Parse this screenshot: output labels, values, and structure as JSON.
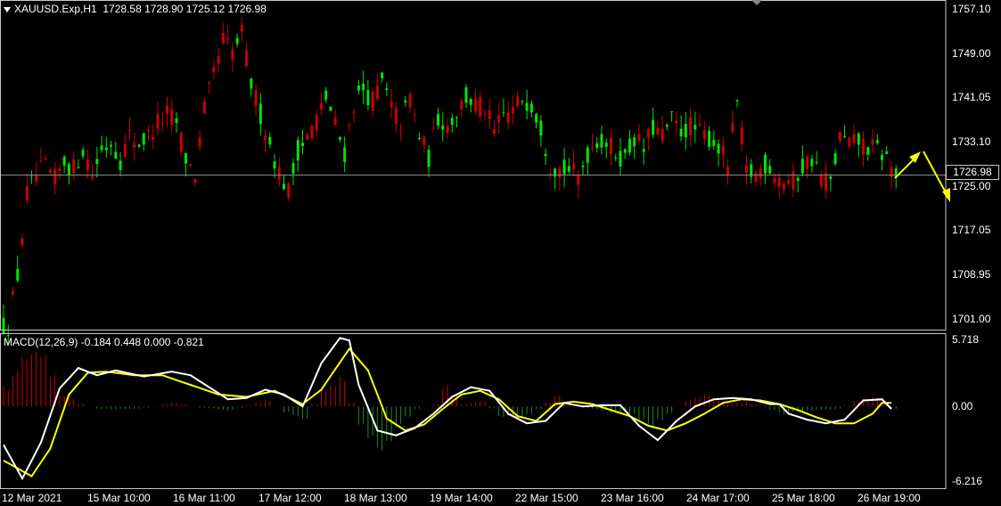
{
  "symbol_header": {
    "symbol": "XAUUSD.Exp,H1",
    "ohlc": "1728.58 1728.90 1725.12 1726.98"
  },
  "current_price": "1726.98",
  "macd_header": "MACD(12,26,9) -0.184 0.448 0.000 -0.821",
  "price_axis": [
    "1757.10",
    "1749.00",
    "1741.05",
    "1733.10",
    "1725.00",
    "1717.05",
    "1708.95",
    "1701.00"
  ],
  "macd_axis": [
    "5.718",
    "0.00",
    "-6.216"
  ],
  "time_axis": [
    "12 Mar 2021",
    "15 Mar 10:00",
    "16 Mar 11:00",
    "17 Mar 12:00",
    "18 Mar 13:00",
    "19 Mar 14:00",
    "22 Mar 15:00",
    "23 Mar 16:00",
    "24 Mar 17:00",
    "25 Mar 18:00",
    "26 Mar 19:00"
  ],
  "colors": {
    "bull": "#00e600",
    "bear": "#cc0000",
    "macd_line": "#ffffff",
    "signal_line": "#ffff00",
    "hist_pos": "#cc0000",
    "hist_neg": "#1f8a1f",
    "arrow": "#ffff00",
    "grid": "#c8c8c8"
  },
  "chart_data": {
    "type": "line",
    "price_range": [
      1699.0,
      1758.5
    ],
    "macd_range": [
      -6.8,
      6.1
    ],
    "close_path": [
      [
        0,
        1699.8
      ],
      [
        0.5,
        1705.0
      ],
      [
        1,
        1708.8
      ],
      [
        1.5,
        1717.5
      ],
      [
        2,
        1723.5
      ],
      [
        3,
        1727.0
      ],
      [
        4,
        1728.2
      ],
      [
        5,
        1726.0
      ],
      [
        6,
        1729.4
      ],
      [
        7,
        1728.0
      ],
      [
        8,
        1731.8
      ],
      [
        9,
        1727.2
      ],
      [
        10,
        1731.5
      ],
      [
        11,
        1733.0
      ],
      [
        12,
        1729.8
      ],
      [
        13,
        1734.0
      ],
      [
        14,
        1732.8
      ],
      [
        15,
        1734.0
      ],
      [
        16,
        1736.5
      ],
      [
        17,
        1738.0
      ],
      [
        18,
        1736.4
      ],
      [
        19,
        1730.0
      ],
      [
        20,
        1727.0
      ],
      [
        21,
        1738.8
      ],
      [
        22,
        1745.0
      ],
      [
        23,
        1751.5
      ],
      [
        24,
        1749.2
      ],
      [
        25,
        1752.5
      ],
      [
        26,
        1743.5
      ],
      [
        27,
        1738.0
      ],
      [
        28,
        1732.5
      ],
      [
        29,
        1727.5
      ],
      [
        30,
        1724.0
      ],
      [
        31,
        1731.5
      ],
      [
        32,
        1733.8
      ],
      [
        33,
        1737.0
      ],
      [
        34,
        1741.0
      ],
      [
        35,
        1736.0
      ],
      [
        36,
        1731.0
      ],
      [
        37,
        1740.0
      ],
      [
        38,
        1742.5
      ],
      [
        39,
        1740.5
      ],
      [
        40,
        1743.8
      ],
      [
        41,
        1739.0
      ],
      [
        42,
        1736.2
      ],
      [
        43,
        1741.0
      ],
      [
        44,
        1734.0
      ],
      [
        45,
        1730.2
      ],
      [
        46,
        1737.5
      ],
      [
        47,
        1736.0
      ],
      [
        48,
        1738.5
      ],
      [
        49,
        1741.0
      ],
      [
        50,
        1739.8
      ],
      [
        51,
        1739.0
      ],
      [
        52,
        1734.5
      ],
      [
        53,
        1737.8
      ],
      [
        54,
        1738.5
      ],
      [
        55,
        1741.0
      ],
      [
        56,
        1740.0
      ],
      [
        57,
        1735.8
      ],
      [
        58,
        1729.0
      ],
      [
        59,
        1728.0
      ],
      [
        60,
        1727.8
      ],
      [
        61,
        1726.5
      ],
      [
        62,
        1731.0
      ],
      [
        63,
        1733.5
      ],
      [
        64,
        1732.8
      ],
      [
        65,
        1731.0
      ],
      [
        66,
        1730.0
      ],
      [
        67,
        1733.8
      ],
      [
        68,
        1731.5
      ],
      [
        69,
        1735.5
      ],
      [
        70,
        1734.0
      ],
      [
        71,
        1736.8
      ],
      [
        72,
        1735.0
      ],
      [
        73,
        1735.8
      ],
      [
        74,
        1734.5
      ],
      [
        75,
        1733.8
      ],
      [
        76,
        1732.0
      ],
      [
        77,
        1729.0
      ],
      [
        78,
        1740.0
      ],
      [
        79,
        1727.5
      ],
      [
        80,
        1727.0
      ],
      [
        81,
        1729.0
      ],
      [
        82,
        1727.5
      ],
      [
        83,
        1726.0
      ],
      [
        84,
        1725.8
      ],
      [
        85,
        1728.5
      ],
      [
        86,
        1730.0
      ],
      [
        87,
        1726.8
      ],
      [
        88,
        1725.5
      ],
      [
        89,
        1733.8
      ],
      [
        90,
        1732.5
      ],
      [
        91,
        1733.0
      ],
      [
        92,
        1732.0
      ],
      [
        93,
        1731.5
      ],
      [
        94,
        1730.0
      ],
      [
        95,
        1726.98
      ]
    ],
    "macd_path": [
      [
        0,
        -3.2
      ],
      [
        2,
        -6.0
      ],
      [
        4,
        -3.0
      ],
      [
        6,
        1.5
      ],
      [
        8,
        3.2
      ],
      [
        10,
        2.6
      ],
      [
        12,
        3.0
      ],
      [
        15,
        2.5
      ],
      [
        18,
        2.9
      ],
      [
        20,
        2.6
      ],
      [
        22,
        1.6
      ],
      [
        24,
        0.6
      ],
      [
        26,
        0.7
      ],
      [
        28,
        1.4
      ],
      [
        30,
        1.0
      ],
      [
        32,
        0.0
      ],
      [
        34,
        3.6
      ],
      [
        36,
        5.7
      ],
      [
        37,
        5.5
      ],
      [
        38,
        1.8
      ],
      [
        40,
        -2.0
      ],
      [
        42,
        -2.4
      ],
      [
        44,
        -1.8
      ],
      [
        46,
        -0.6
      ],
      [
        48,
        0.8
      ],
      [
        50,
        1.6
      ],
      [
        52,
        1.3
      ],
      [
        54,
        -0.6
      ],
      [
        56,
        -1.4
      ],
      [
        58,
        -1.2
      ],
      [
        60,
        0.3
      ],
      [
        62,
        0.0
      ],
      [
        64,
        0.1
      ],
      [
        66,
        0.1
      ],
      [
        68,
        -1.6
      ],
      [
        70,
        -2.8
      ],
      [
        72,
        -1.2
      ],
      [
        74,
        0.0
      ],
      [
        76,
        0.6
      ],
      [
        78,
        0.7
      ],
      [
        80,
        0.6
      ],
      [
        82,
        0.2
      ],
      [
        83,
        0.2
      ],
      [
        84,
        -0.6
      ],
      [
        86,
        -1.1
      ],
      [
        88,
        -1.4
      ],
      [
        90,
        -1.1
      ],
      [
        92,
        0.5
      ],
      [
        94,
        0.6
      ],
      [
        95,
        -0.2
      ]
    ],
    "signal_path": [
      [
        0,
        -4.5
      ],
      [
        3,
        -5.8
      ],
      [
        5,
        -3.5
      ],
      [
        7,
        1.0
      ],
      [
        9,
        2.8
      ],
      [
        11,
        2.9
      ],
      [
        14,
        2.6
      ],
      [
        17,
        2.6
      ],
      [
        20,
        1.8
      ],
      [
        23,
        1.0
      ],
      [
        26,
        0.8
      ],
      [
        29,
        1.3
      ],
      [
        32,
        0.2
      ],
      [
        34,
        1.4
      ],
      [
        37,
        4.8
      ],
      [
        39,
        3.0
      ],
      [
        41,
        -1.0
      ],
      [
        43,
        -2.0
      ],
      [
        45,
        -1.5
      ],
      [
        47,
        -0.2
      ],
      [
        49,
        1.0
      ],
      [
        51,
        1.3
      ],
      [
        53,
        0.6
      ],
      [
        55,
        -0.8
      ],
      [
        57,
        -1.2
      ],
      [
        59,
        0.2
      ],
      [
        61,
        0.4
      ],
      [
        63,
        0.2
      ],
      [
        65,
        -0.3
      ],
      [
        67,
        -0.8
      ],
      [
        69,
        -1.6
      ],
      [
        71,
        -2.0
      ],
      [
        73,
        -1.4
      ],
      [
        75,
        -0.6
      ],
      [
        77,
        0.3
      ],
      [
        79,
        0.6
      ],
      [
        81,
        0.5
      ],
      [
        83,
        0.2
      ],
      [
        85,
        -0.3
      ],
      [
        87,
        -0.9
      ],
      [
        89,
        -1.4
      ],
      [
        91,
        -1.4
      ],
      [
        93,
        -0.6
      ],
      [
        94,
        0.3
      ],
      [
        95,
        0.3
      ]
    ],
    "hist_path": [
      [
        0,
        1.5
      ],
      [
        3,
        4.8
      ],
      [
        4,
        4.0
      ],
      [
        6,
        1.0
      ],
      [
        8,
        0.2
      ],
      [
        10,
        -0.2
      ],
      [
        14,
        -0.2
      ],
      [
        18,
        0.3
      ],
      [
        21,
        -0.1
      ],
      [
        24,
        -0.3
      ],
      [
        27,
        0.3
      ],
      [
        28,
        0.5
      ],
      [
        30,
        -0.5
      ],
      [
        32,
        -1.0
      ],
      [
        34,
        1.4
      ],
      [
        36,
        2.2
      ],
      [
        38,
        -1.5
      ],
      [
        40,
        -3.8
      ],
      [
        42,
        -1.5
      ],
      [
        44,
        -0.2
      ],
      [
        46,
        0.2
      ],
      [
        47,
        1.7
      ],
      [
        49,
        0.2
      ],
      [
        51,
        0.5
      ],
      [
        53,
        -0.8
      ],
      [
        55,
        -1.0
      ],
      [
        57,
        -0.2
      ],
      [
        59,
        0.8
      ],
      [
        61,
        0.0
      ],
      [
        63,
        -0.2
      ],
      [
        65,
        -0.5
      ],
      [
        67,
        -0.6
      ],
      [
        69,
        -1.6
      ],
      [
        71,
        -0.5
      ],
      [
        73,
        0.5
      ],
      [
        75,
        1.0
      ],
      [
        77,
        0.4
      ],
      [
        79,
        0.3
      ],
      [
        81,
        0.1
      ],
      [
        83,
        -0.6
      ],
      [
        85,
        -0.4
      ],
      [
        87,
        -0.3
      ],
      [
        89,
        -0.2
      ],
      [
        91,
        0.4
      ],
      [
        93,
        0.8
      ],
      [
        95,
        -0.2
      ]
    ]
  }
}
